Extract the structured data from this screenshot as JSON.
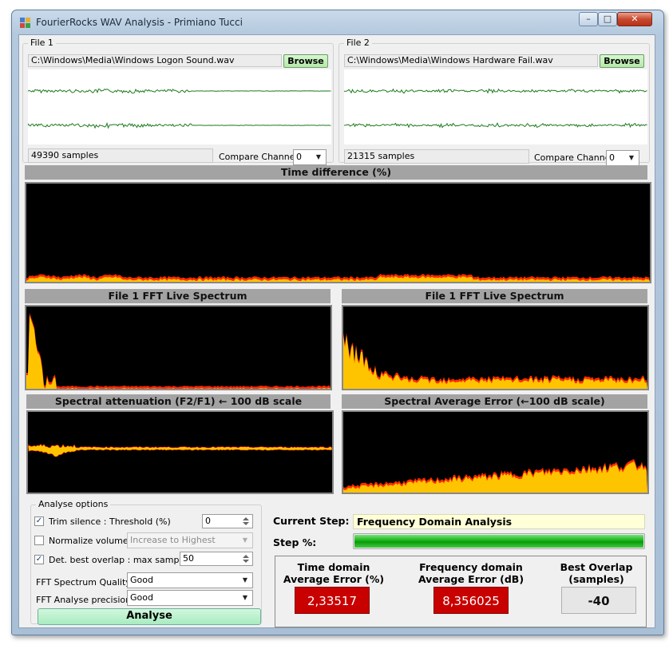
{
  "window": {
    "title": "FourierRocks WAV Analysis - Primiano Tucci",
    "controls": {
      "minimize": "–",
      "maximize": "□",
      "close": "✕"
    }
  },
  "file1": {
    "group_label": "File 1",
    "path": "C:\\Windows\\Media\\Windows Logon Sound.wav",
    "browse_label": "Browse",
    "samples": "49390 samples",
    "compare_label": "Compare Channel",
    "channel": "0"
  },
  "file2": {
    "group_label": "File 2",
    "path": "C:\\Windows\\Media\\Windows Hardware Fail.wav",
    "browse_label": "Browse",
    "samples": "21315 samples",
    "compare_label": "Compare Channel",
    "channel": "0"
  },
  "panels": {
    "time_diff": "Time difference (%)",
    "fft1": "File 1 FFT Live Spectrum",
    "fft2": "File 1 FFT Live Spectrum",
    "atten": "Spectral attenuation (F2/F1) ← 100 dB scale",
    "avg_err": "Spectral Average Error (←100 dB scale)"
  },
  "options": {
    "group_label": "Analyse options",
    "trim_label": "Trim silence : Threshold (%)",
    "trim_checked": true,
    "trim_value": "0",
    "normalize_label": "Normalize volume",
    "normalize_checked": false,
    "normalize_mode": "Increase to Highest",
    "overlap_label": "Det. best overlap : max samples",
    "overlap_checked": true,
    "overlap_value": "50",
    "fft_quality_label": "FFT Spectrum Quality",
    "fft_quality": "Good",
    "fft_precision_label": "FFT Analyse precision",
    "fft_precision": "Good",
    "analyse_label": "Analyse"
  },
  "status": {
    "current_step_label": "Current Step:",
    "current_step": "Frequency Domain Analysis",
    "step_pct_label": "Step %:",
    "step_progress": 1.0
  },
  "results": {
    "time_error_label": "Time domain Average Error (%)",
    "time_error": "2,33517",
    "freq_error_label": "Frequency domain Average Error (dB)",
    "freq_error": "8,356025",
    "overlap_label": "Best Overlap (samples)",
    "overlap": "-40"
  },
  "colors": {
    "waveform": "#1e7a1e",
    "spectrum_fill": "#ffc400",
    "spectrum_edge": "#ff2a00",
    "result_red": "#c80000",
    "progress_green": "#16b316"
  }
}
